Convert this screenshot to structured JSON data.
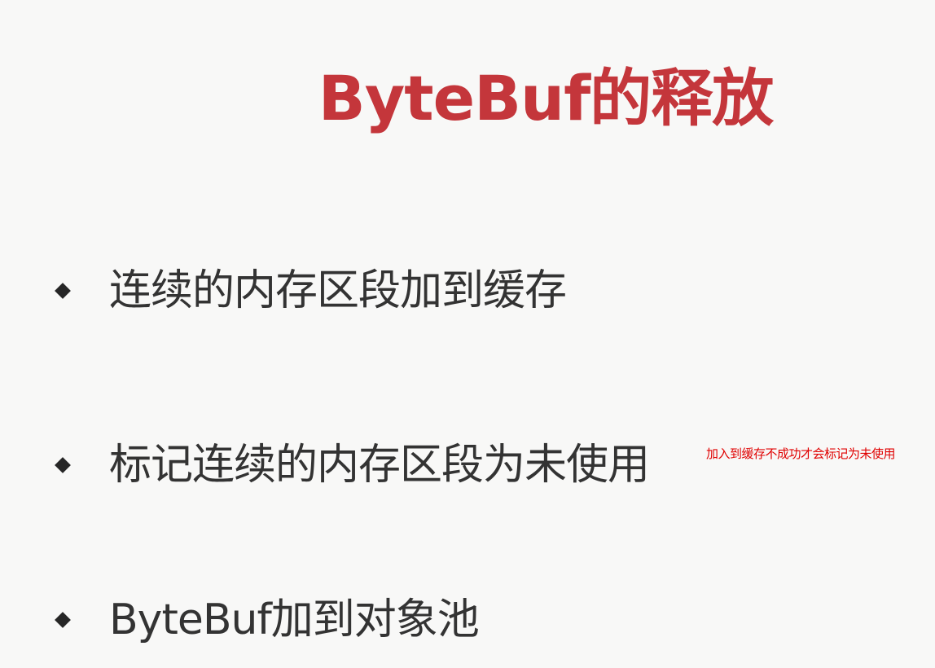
{
  "slide": {
    "title": "ByteBuf的释放",
    "bullets": [
      {
        "text": "连续的内存区段加到缓存"
      },
      {
        "text": "标记连续的内存区段为未使用"
      },
      {
        "text": "ByteBuf加到对象池"
      }
    ]
  },
  "annotation": {
    "text": "加入到缓存不成功才会标记为未使用"
  },
  "colors": {
    "title": "#c4363b",
    "bullet_text": "#333333",
    "bullet_marker": "#262626",
    "annotation": "#e00000",
    "background": "#f8f8f7"
  },
  "icons": {
    "bullet_marker": "diamond-bullet-icon"
  }
}
